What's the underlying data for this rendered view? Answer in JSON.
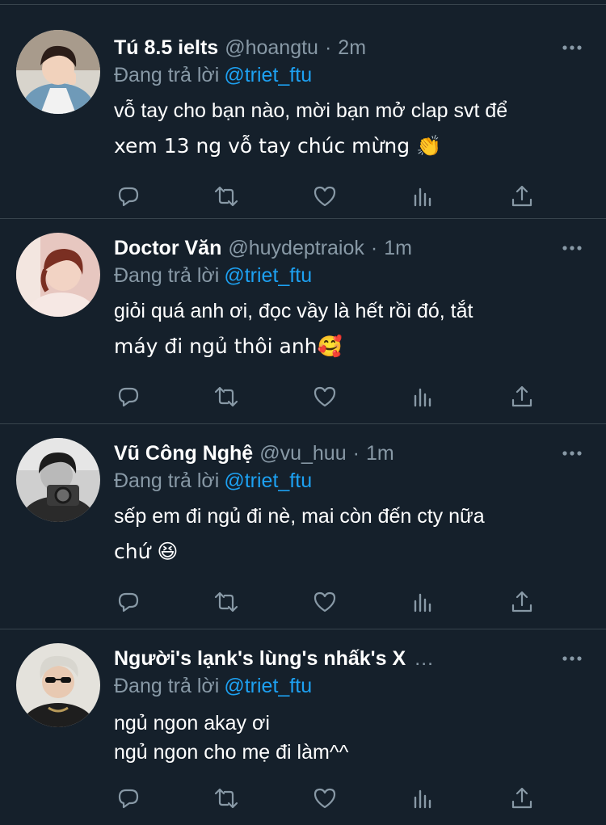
{
  "colors": {
    "background": "#15202b",
    "divider": "#38444d",
    "secondary_text": "#8899a6",
    "link": "#1da1f2"
  },
  "reply_prefix": "Đang trả lời",
  "tweets": [
    {
      "name": "Tú 8.5 ielts",
      "handle": "@hoangtu",
      "dot": "·",
      "time": "2m",
      "reply_to": "@triet_ftu",
      "text_line1": "vỗ tay cho bạn nào, mời bạn mở clap svt để",
      "text_line2": "xem 13 ng vỗ tay chúc mừng 👏"
    },
    {
      "name": "Doctor Văn",
      "handle": "@huydeptraiok",
      "dot": "·",
      "time": "1m",
      "reply_to": "@triet_ftu",
      "text_line1": "giỏi quá anh ơi, đọc vầy là hết rồi đó, tắt",
      "text_line2": "máy đi ngủ thôi anh🥰"
    },
    {
      "name": "Vũ Công Nghệ",
      "handle": "@vu_huu",
      "dot": "·",
      "time": "1m",
      "reply_to": "@triet_ftu",
      "text_line1": "sếp em đi ngủ đi nè, mai còn đến cty nữa",
      "text_line2": "chứ 😆"
    },
    {
      "name": "Người's lạnk's lùng's nhấk's X",
      "handle": "",
      "dot": "…",
      "time": "",
      "reply_to": "@triet_ftu",
      "text_line1": "ngủ ngon akay ơi",
      "text_line2": "ngủ ngon cho mẹ đi làm^^"
    }
  ],
  "icons": {
    "more": "more-horizontal-icon",
    "reply": "reply-icon",
    "retweet": "retweet-icon",
    "like": "heart-icon",
    "analytics": "analytics-icon",
    "share": "share-icon"
  }
}
